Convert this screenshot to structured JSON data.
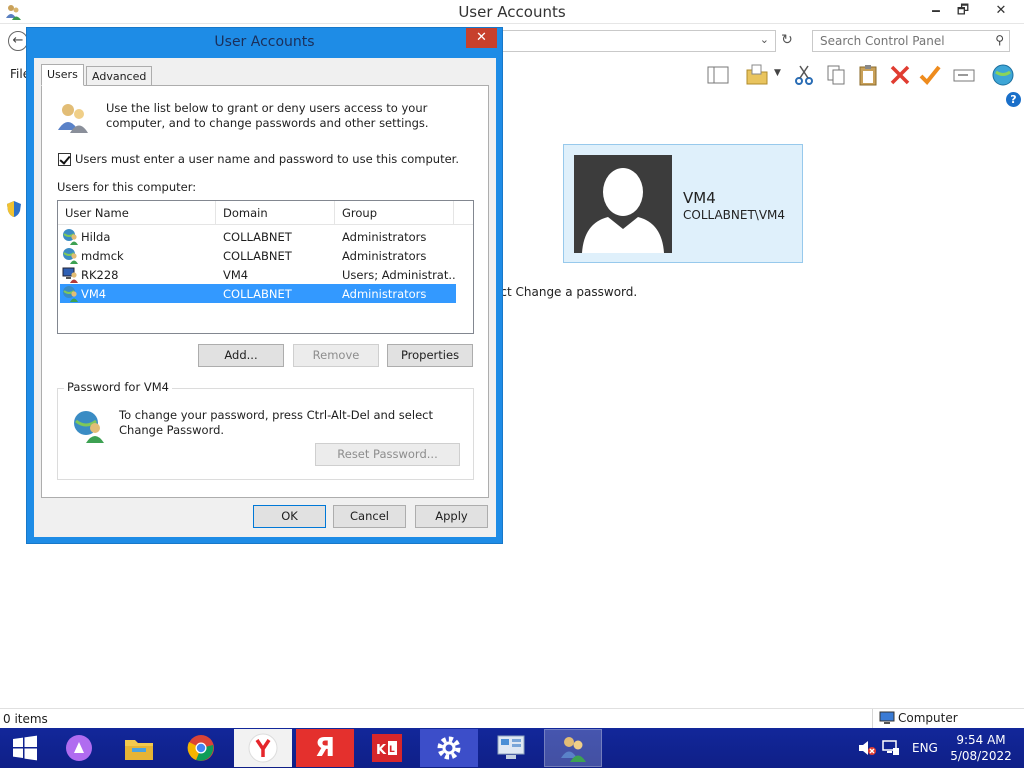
{
  "window": {
    "title": "User Accounts",
    "search_placeholder": "Search Control Panel",
    "menu_file": "File",
    "minimize": "🗕",
    "maximize": "🗗",
    "close": "✕"
  },
  "background": {
    "user_card": {
      "name": "VM4",
      "domain": "COLLABNET\\VM4"
    },
    "password_hint": "ect Change a password."
  },
  "dialog": {
    "title": "User Accounts",
    "close": "✕",
    "tabs": [
      {
        "label": "Users",
        "selected": true
      },
      {
        "label": "Advanced",
        "selected": false
      }
    ],
    "intro_text": "Use the list below to grant or deny users access to your computer, and to change passwords and other settings.",
    "must_enter_checkbox": {
      "label": "Users must enter a user name and password to use this computer.",
      "checked": true
    },
    "users_label": "Users for this computer:",
    "columns": [
      "User Name",
      "Domain",
      "Group"
    ],
    "users": [
      {
        "name": "Hilda",
        "domain": "COLLABNET",
        "group": "Administrators",
        "icon": "domain-user-icon",
        "selected": false
      },
      {
        "name": "mdmck",
        "domain": "COLLABNET",
        "group": "Administrators",
        "icon": "domain-user-icon",
        "selected": false
      },
      {
        "name": "RK228",
        "domain": "VM4",
        "group": "Users; Administrat...",
        "icon": "local-user-icon",
        "selected": false
      },
      {
        "name": "VM4",
        "domain": "COLLABNET",
        "group": "Administrators",
        "icon": "domain-user-icon",
        "selected": true
      }
    ],
    "buttons": {
      "add": "Add...",
      "remove": "Remove",
      "properties": "Properties"
    },
    "password_group": {
      "legend": "Password for VM4",
      "text": "To change your password, press Ctrl-Alt-Del and select Change Password.",
      "reset_button": "Reset Password..."
    },
    "footer": {
      "ok": "OK",
      "cancel": "Cancel",
      "apply": "Apply"
    }
  },
  "statusbar": {
    "items": "0 items",
    "zone": "Computer"
  },
  "taskbar": {
    "apps": [
      "start-icon",
      "alice-icon",
      "file-explorer-icon",
      "chrome-icon",
      "yandex-browser-icon",
      "yandex-icon",
      "kaspersky-icon",
      "settings-icon",
      "control-panel-icon",
      "user-accounts-icon"
    ],
    "language": "ENG",
    "time": "9:54 AM",
    "date": "5/08/2022"
  },
  "colors": {
    "accent": "#1e8ce6",
    "taskbar": "#12279a",
    "selection": "#3399ff",
    "card": "#dff0fb"
  }
}
